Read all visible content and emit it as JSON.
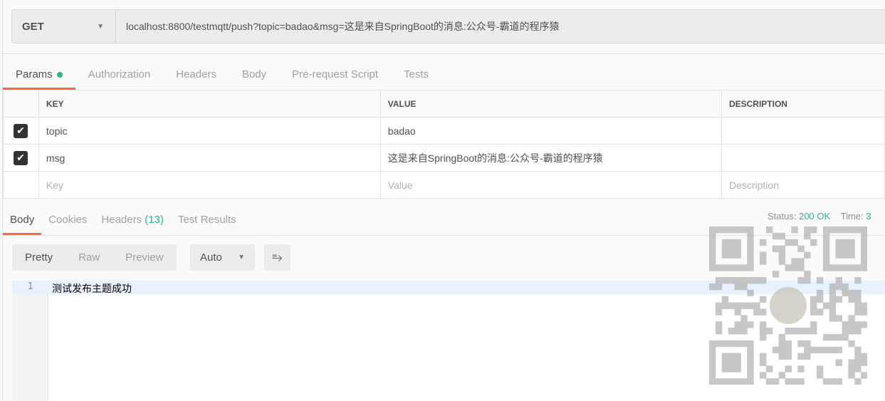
{
  "request": {
    "method": "GET",
    "url": "localhost:8800/testmqtt/push?topic=badao&msg=这是来自SpringBoot的消息:公众号-霸道的程序猿"
  },
  "request_tabs": [
    "Params",
    "Authorization",
    "Headers",
    "Body",
    "Pre-request Script",
    "Tests"
  ],
  "params": {
    "headers": [
      "KEY",
      "VALUE",
      "DESCRIPTION"
    ],
    "rows": [
      {
        "checked": true,
        "key": "topic",
        "value": "badao",
        "description": ""
      },
      {
        "checked": true,
        "key": "msg",
        "value": "这是来自SpringBoot的消息:公众号-霸道的程序猿",
        "description": ""
      }
    ],
    "placeholder": {
      "key": "Key",
      "value": "Value",
      "description": "Description"
    }
  },
  "response_tabs": {
    "body": "Body",
    "cookies": "Cookies",
    "headers": "Headers",
    "headers_count": "(13)",
    "tests": "Test Results"
  },
  "status": {
    "label": "Status:",
    "value": "200 OK",
    "time_label": "Time:",
    "time_value": "3"
  },
  "view": {
    "pretty": "Pretty",
    "raw": "Raw",
    "preview": "Preview",
    "format": "Auto"
  },
  "body": {
    "line_number": "1",
    "text": "测试发布主题成功"
  },
  "colors": {
    "accent": "#f26b3a",
    "success": "#27b77f"
  }
}
